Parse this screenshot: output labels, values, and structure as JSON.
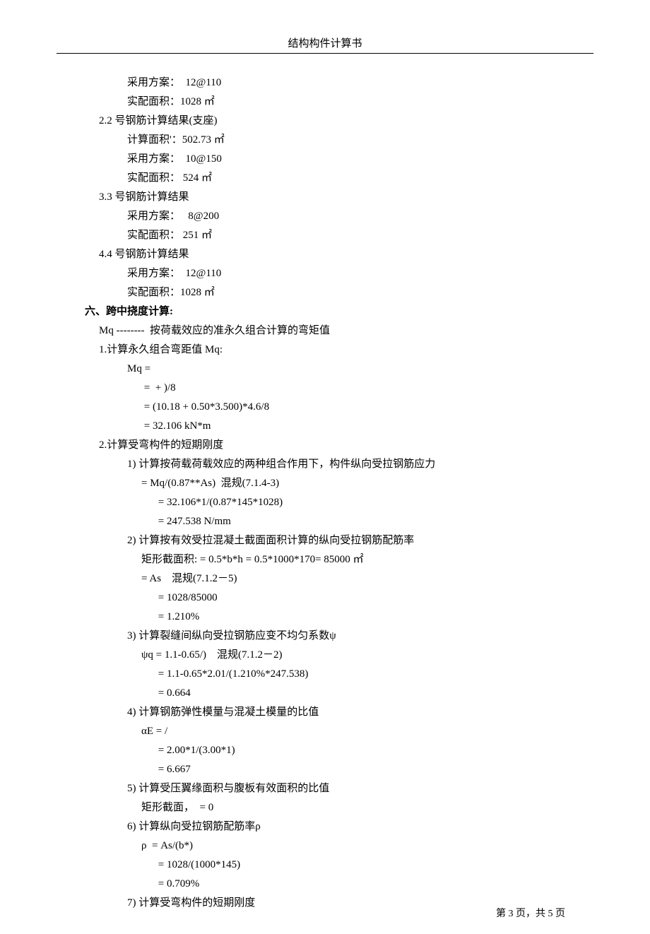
{
  "header": "结构构件计算书",
  "footer": {
    "prefix": "第 ",
    "page": "3",
    "mid": " 页，共 ",
    "total": "5",
    "suffix": " 页"
  },
  "lines": [
    {
      "cls": "ind2",
      "text": "采用方案：  12@110"
    },
    {
      "cls": "ind2",
      "text": "实配面积：1028 ㎡"
    },
    {
      "cls": "ind1",
      "text": "2.2 号钢筋计算结果(支座)"
    },
    {
      "cls": "ind2",
      "text": "计算面积'：502.73 ㎡"
    },
    {
      "cls": "ind2",
      "text": "采用方案：  10@150"
    },
    {
      "cls": "ind2",
      "text": "实配面积： 524 ㎡"
    },
    {
      "cls": "ind1",
      "text": "3.3 号钢筋计算结果"
    },
    {
      "cls": "ind2",
      "text": "采用方案：   8@200"
    },
    {
      "cls": "ind2",
      "text": "实配面积： 251 ㎡"
    },
    {
      "cls": "ind1",
      "text": "4.4 号钢筋计算结果"
    },
    {
      "cls": "ind2",
      "text": "采用方案：  12@110"
    },
    {
      "cls": "ind2",
      "text": "实配面积：1028 ㎡"
    },
    {
      "cls": "heading",
      "text": "六、跨中挠度计算:"
    },
    {
      "cls": "ind1",
      "text": "Mq --------  按荷载效应的准永久组合计算的弯矩值"
    },
    {
      "cls": "ind1",
      "text": "1.计算永久组合弯距值 Mq:"
    },
    {
      "cls": "ind2",
      "text": "Mq ="
    },
    {
      "cls": "ind3",
      "text": " =  + )/8"
    },
    {
      "cls": "ind3",
      "text": " = (10.18 + 0.50*3.500)*4.6/8"
    },
    {
      "cls": "ind3",
      "text": " = 32.106 kN*m"
    },
    {
      "cls": "ind1",
      "text": "2.计算受弯构件的短期刚度"
    },
    {
      "cls": "ind2",
      "text": "1) 计算按荷载荷载效应的两种组合作用下，构件纵向受拉钢筋应力"
    },
    {
      "cls": "ind3",
      "text": "= Mq/(0.87**As)  混规(7.1.4-3)"
    },
    {
      "cls": "ind4",
      "text": " = 32.106*1/(0.87*145*1028)"
    },
    {
      "cls": "ind4",
      "text": " = 247.538 N/mm"
    },
    {
      "cls": "ind2",
      "text": "2) 计算按有效受拉混凝土截面面积计算的纵向受拉钢筋配筋率"
    },
    {
      "cls": "ind3",
      "text": "矩形截面积: = 0.5*b*h = 0.5*1000*170= 85000 ㎡"
    },
    {
      "cls": "ind3",
      "text": "= As    混规(7.1.2－5)"
    },
    {
      "cls": "ind4",
      "text": " = 1028/85000"
    },
    {
      "cls": "ind4",
      "text": " = 1.210%"
    },
    {
      "cls": "ind2",
      "text": "3) 计算裂缝间纵向受拉钢筋应变不均匀系数ψ"
    },
    {
      "cls": "ind3",
      "text": "ψq = 1.1-0.65/)    混规(7.1.2－2)"
    },
    {
      "cls": "ind4",
      "text": " = 1.1-0.65*2.01/(1.210%*247.538)"
    },
    {
      "cls": "ind4",
      "text": " = 0.664"
    },
    {
      "cls": "ind2",
      "text": "4) 计算钢筋弹性模量与混凝土模量的比值"
    },
    {
      "cls": "ind3",
      "text": "αE = /"
    },
    {
      "cls": "ind4",
      "text": " = 2.00*1/(3.00*1)"
    },
    {
      "cls": "ind4",
      "text": " = 6.667"
    },
    {
      "cls": "ind2",
      "text": "5) 计算受压翼缘面积与腹板有效面积的比值"
    },
    {
      "cls": "ind3",
      "text": "矩形截面，  = 0"
    },
    {
      "cls": "ind2",
      "text": "6) 计算纵向受拉钢筋配筋率ρ"
    },
    {
      "cls": "ind3",
      "text": "ρ  = As/(b*)"
    },
    {
      "cls": "ind4",
      "text": " = 1028/(1000*145)"
    },
    {
      "cls": "ind4",
      "text": " = 0.709%"
    },
    {
      "cls": "ind2",
      "text": "7) 计算受弯构件的短期刚度"
    }
  ]
}
